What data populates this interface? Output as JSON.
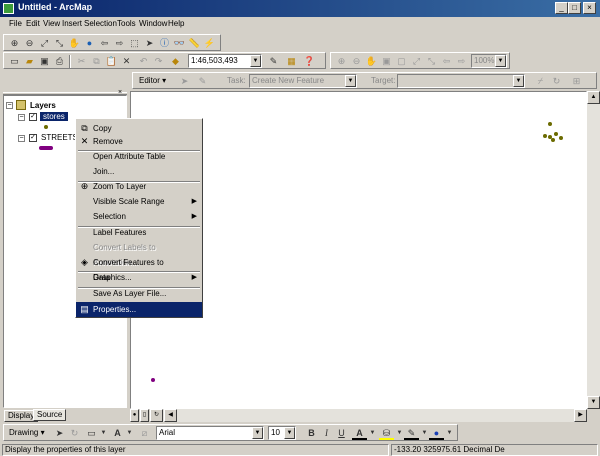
{
  "window": {
    "title": "Untitled - ArcMap",
    "minimize": "_",
    "maximize": "□",
    "close": "×"
  },
  "menubar": [
    "File",
    "Edit",
    "View",
    "Insert",
    "Selection",
    "Tools",
    "Window",
    "Help"
  ],
  "standard_toolbar": {
    "scale_value": "1:46,503,493",
    "zoom_percent": "100%"
  },
  "editor_toolbar": {
    "editor_label": "Editor",
    "task_label": "Task:",
    "task_value": "Create New Feature",
    "target_label": "Target:"
  },
  "toc": {
    "root_label": "Layers",
    "layers": [
      {
        "name": "stores",
        "checked": true,
        "selected": true
      },
      {
        "name": "STREETS",
        "checked": true,
        "selected": false
      }
    ],
    "tabs": [
      "Display",
      "Source"
    ]
  },
  "context_menu": {
    "items": [
      {
        "label": "Copy",
        "icon": "copy-icon",
        "glyph": "⧉",
        "enabled": true
      },
      {
        "label": "Remove",
        "icon": "remove-icon",
        "glyph": "✕",
        "enabled": true
      },
      {
        "label": "Open Attribute Table",
        "enabled": true
      },
      {
        "label": "Join...",
        "enabled": true
      },
      {
        "label": "Zoom To Layer",
        "icon": "zoom-to-layer-icon",
        "glyph": "⊕",
        "enabled": true
      },
      {
        "label": "Visible Scale Range",
        "enabled": true,
        "submenu": true
      },
      {
        "label": "Selection",
        "enabled": true,
        "submenu": true
      },
      {
        "label": "Label Features",
        "enabled": true
      },
      {
        "label": "Convert Labels to Annotation...",
        "enabled": false
      },
      {
        "label": "Convert Features to Graphics...",
        "icon": "convert-graphics-icon",
        "glyph": "◈",
        "enabled": true
      },
      {
        "label": "Data",
        "enabled": true,
        "submenu": true
      },
      {
        "label": "Save As Layer File...",
        "enabled": true
      },
      {
        "label": "Properties...",
        "icon": "properties-icon",
        "glyph": "▤",
        "enabled": true,
        "highlighted": true
      }
    ]
  },
  "draw_toolbar": {
    "drawing_label": "Drawing",
    "font_name": "Arial",
    "font_size": "10",
    "bold": "B",
    "italic": "I",
    "underline": "U",
    "font_color_label": "A"
  },
  "status_bar": {
    "message": "Display the properties of this layer",
    "coordinates": "-133.20  325975.61 Decimal De"
  },
  "colors": {
    "title_active": "#0a246a",
    "highlight": "#0a246a",
    "store_points": "#7a7a00",
    "street_symbol": "#800080"
  }
}
